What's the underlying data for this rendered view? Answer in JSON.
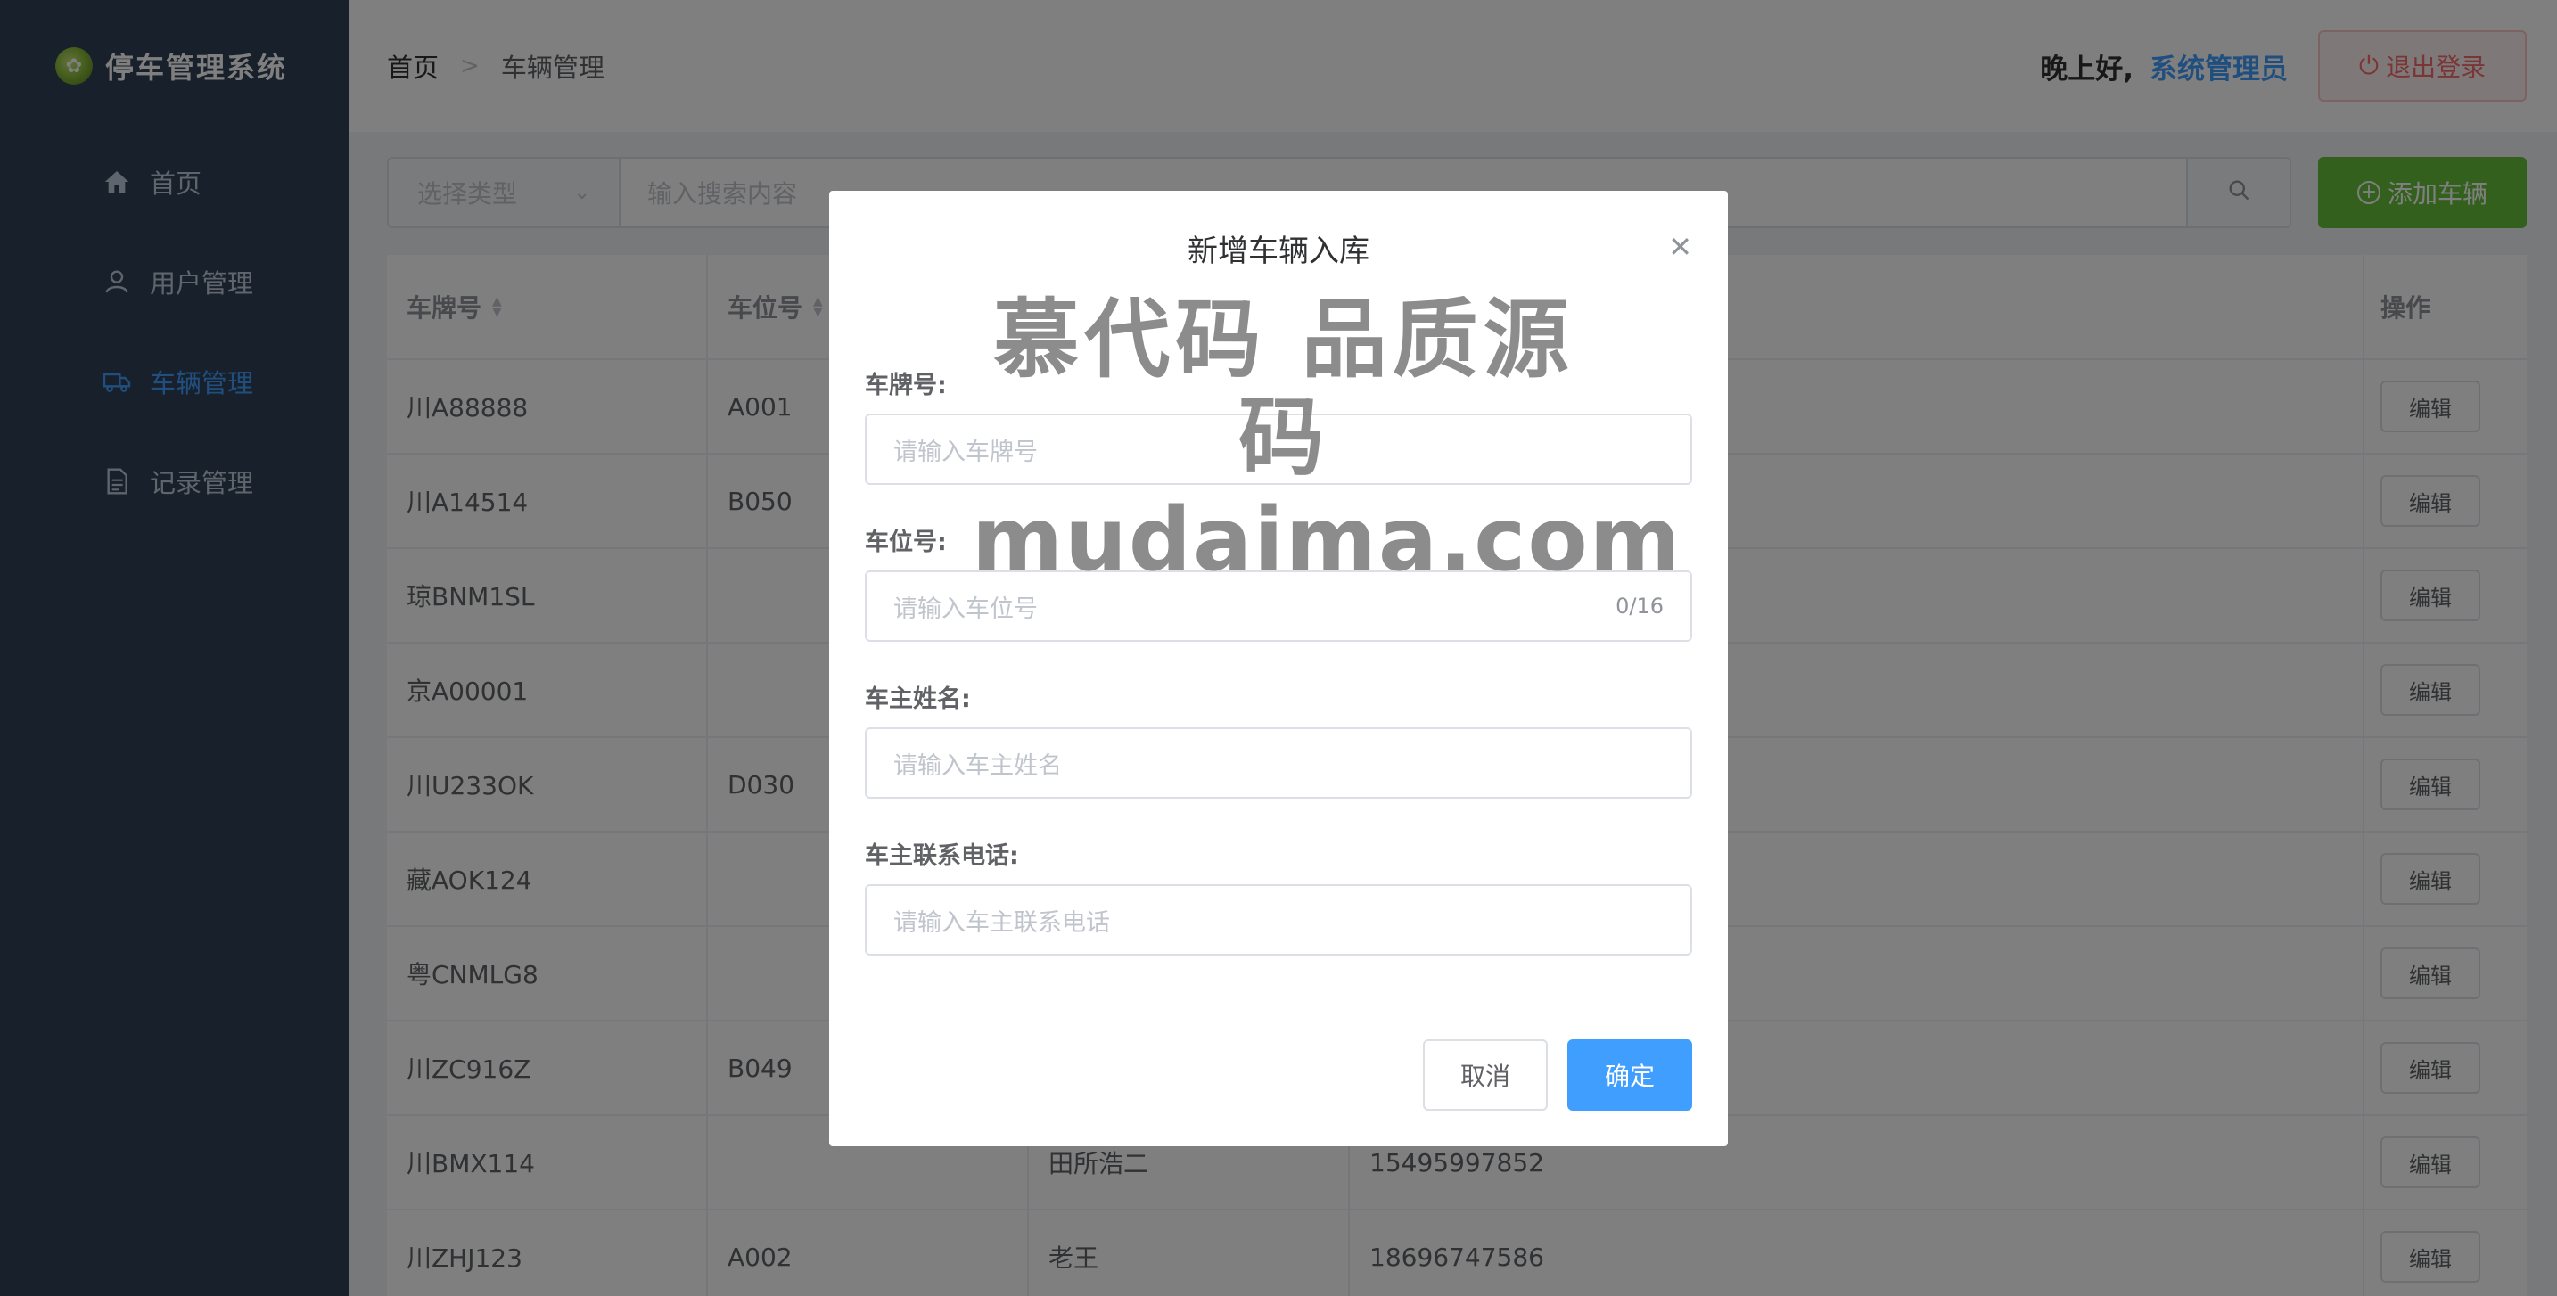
{
  "app": {
    "title": "停车管理系统"
  },
  "sidebar": {
    "items": [
      {
        "label": "首页",
        "icon": "home-icon",
        "active": false
      },
      {
        "label": "用户管理",
        "icon": "user-icon",
        "active": false
      },
      {
        "label": "车辆管理",
        "icon": "truck-icon",
        "active": true
      },
      {
        "label": "记录管理",
        "icon": "document-icon",
        "active": false
      }
    ]
  },
  "header": {
    "breadcrumb": [
      "首页",
      "车辆管理"
    ],
    "greeting": "晚上好,",
    "username": "系统管理员",
    "logout_label": "退出登录"
  },
  "toolbar": {
    "type_placeholder": "选择类型",
    "search_placeholder": "输入搜索内容",
    "add_label": "添加车辆"
  },
  "table": {
    "columns": [
      "车牌号",
      "车位号",
      "",
      "",
      "操作"
    ],
    "edit_label": "编辑",
    "rows": [
      {
        "plate": "川A88888",
        "slot": "A001",
        "owner": "",
        "phone": ""
      },
      {
        "plate": "川A14514",
        "slot": "B050",
        "owner": "",
        "phone": ""
      },
      {
        "plate": "琼BNM1SL",
        "slot": "",
        "owner": "",
        "phone": ""
      },
      {
        "plate": "京A00001",
        "slot": "",
        "owner": "",
        "phone": ""
      },
      {
        "plate": "川U233OK",
        "slot": "D030",
        "owner": "",
        "phone": ""
      },
      {
        "plate": "藏AOK124",
        "slot": "",
        "owner": "",
        "phone": ""
      },
      {
        "plate": "粤CNMLG8",
        "slot": "",
        "owner": "",
        "phone": ""
      },
      {
        "plate": "川ZC916Z",
        "slot": "B049",
        "owner": "",
        "phone": ""
      },
      {
        "plate": "川BMX114",
        "slot": "",
        "owner": "田所浩二",
        "phone": "15495997852"
      },
      {
        "plate": "川ZHJ123",
        "slot": "A002",
        "owner": "老王",
        "phone": "18696747586"
      }
    ]
  },
  "dialog": {
    "title": "新增车辆入库",
    "fields": [
      {
        "label": "车牌号:",
        "placeholder": "请输入车牌号",
        "counter": ""
      },
      {
        "label": "车位号:",
        "placeholder": "请输入车位号",
        "counter": "0/16"
      },
      {
        "label": "车主姓名:",
        "placeholder": "请输入车主姓名",
        "counter": ""
      },
      {
        "label": "车主联系电话:",
        "placeholder": "请输入车主联系电话",
        "counter": ""
      }
    ],
    "cancel_label": "取消",
    "ok_label": "确定"
  },
  "watermark": {
    "line1": "慕代码 品质源码",
    "line2": "mudaima.com"
  },
  "colors": {
    "primary": "#409eff",
    "success": "#67c23a",
    "danger": "#f56c6c",
    "sidebar": "#304156"
  }
}
